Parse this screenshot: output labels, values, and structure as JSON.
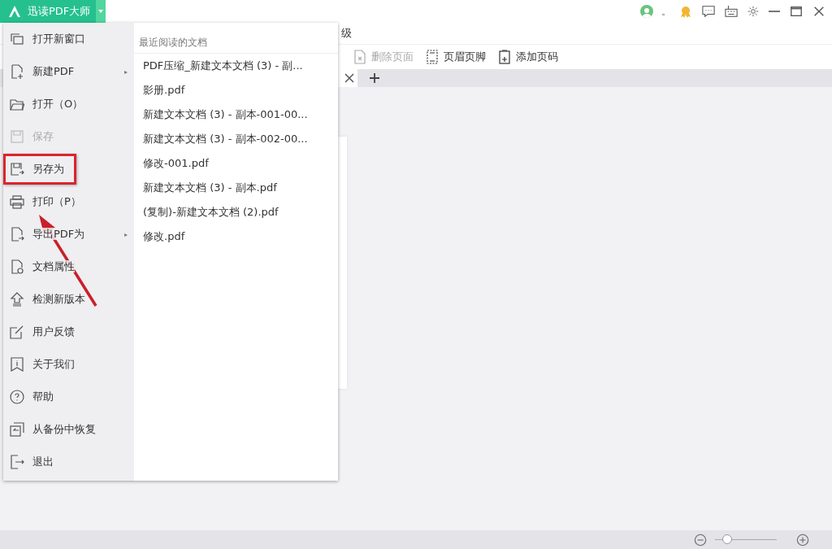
{
  "title_bar": {
    "app_title": "迅读PDF大师",
    "user_text": "。"
  },
  "menu_bar": {
    "items": [
      "级"
    ]
  },
  "toolbar": {
    "items": [
      {
        "label": "删除页面",
        "disabled": true
      },
      {
        "label": "页眉页脚",
        "disabled": false
      },
      {
        "label": "添加页码",
        "disabled": false
      }
    ]
  },
  "app_menu": {
    "items": [
      {
        "label": "打开新窗口",
        "disabled": false,
        "highlighted": false
      },
      {
        "label": "新建PDF",
        "disabled": false,
        "highlighted": false,
        "submenu_arrow": "▸"
      },
      {
        "label": "打开（O）",
        "disabled": false,
        "highlighted": false
      },
      {
        "label": "保存",
        "disabled": true,
        "highlighted": false
      },
      {
        "label": "另存为",
        "disabled": false,
        "highlighted": true
      },
      {
        "label": "打印（P）",
        "disabled": false,
        "highlighted": false
      },
      {
        "label": "导出PDF为",
        "disabled": false,
        "highlighted": false,
        "submenu_arrow": "▸"
      },
      {
        "label": "文档属性",
        "disabled": false,
        "highlighted": false
      },
      {
        "label": "检测新版本",
        "disabled": false,
        "highlighted": false
      },
      {
        "label": "用户反馈",
        "disabled": false,
        "highlighted": false
      },
      {
        "label": "关于我们",
        "disabled": false,
        "highlighted": false
      },
      {
        "label": "帮助",
        "disabled": false,
        "highlighted": false
      },
      {
        "label": "从备份中恢复",
        "disabled": false,
        "highlighted": false
      },
      {
        "label": "退出",
        "disabled": false,
        "highlighted": false
      }
    ],
    "recent": {
      "heading": "最近阅读的文档",
      "files": [
        "PDF压缩_新建文本文档 (3) - 副...",
        "影册.pdf",
        "新建文本文档 (3) - 副本-001-00...",
        "新建文本文档 (3) - 副本-002-00...",
        "修改-001.pdf",
        "新建文本文档 (3) - 副本.pdf",
        "(复制)-新建文本文档 (2).pdf",
        "修改.pdf"
      ]
    }
  },
  "status_bar": {
    "zoom": {
      "level": 0.2
    }
  }
}
